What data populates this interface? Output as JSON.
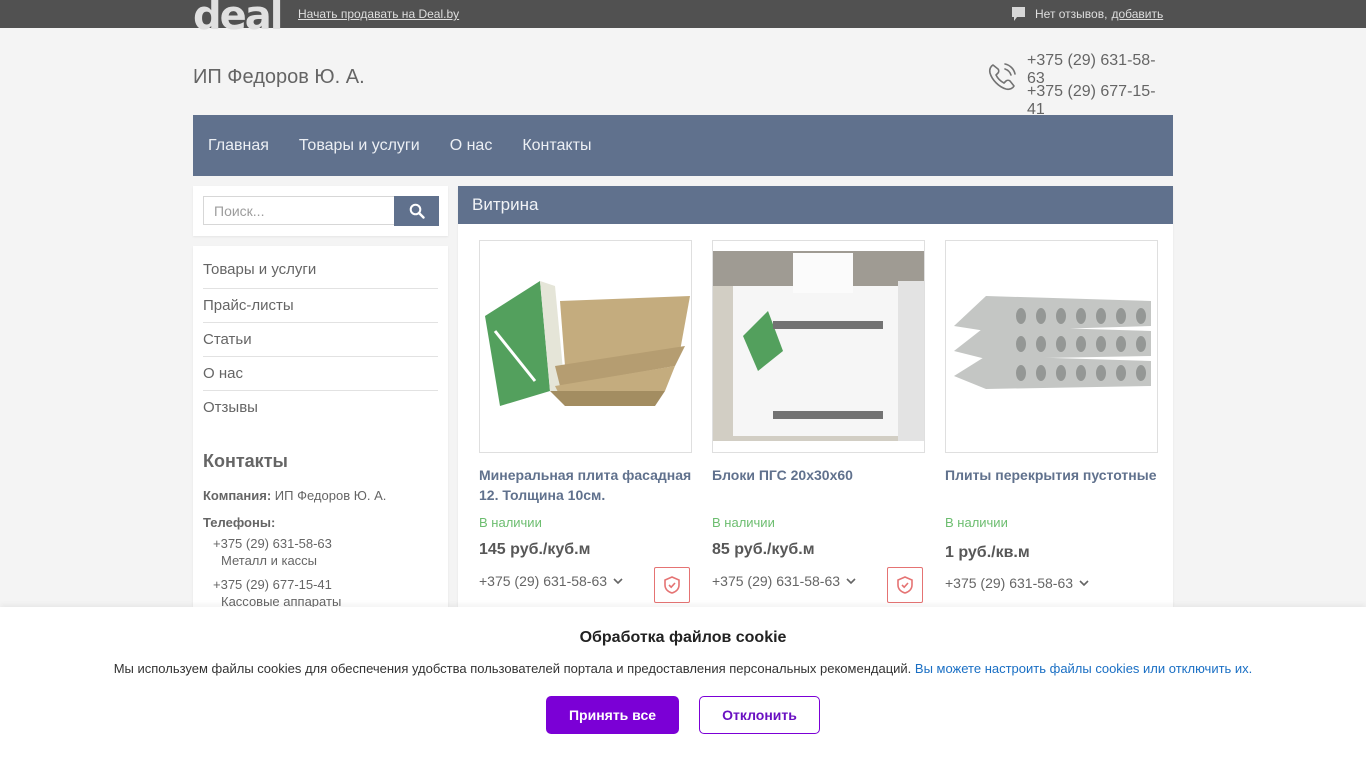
{
  "topbar": {
    "logo": "deal",
    "sell_link": "Начать продавать на Deal.by",
    "reviews_text": "Нет отзывов,",
    "reviews_add": "добавить"
  },
  "header": {
    "company": "ИП Федоров Ю. А.",
    "phone1": "+375 (29) 631-58-63",
    "phone2": "+375 (29) 677-15-41"
  },
  "nav": {
    "items": [
      "Главная",
      "Товары и услуги",
      "О нас",
      "Контакты"
    ]
  },
  "search": {
    "placeholder": "Поиск..."
  },
  "sidebar": {
    "items": [
      "Товары и услуги",
      "Прайс-листы",
      "Статьи",
      "О нас",
      "Отзывы"
    ],
    "contacts_title": "Контакты",
    "company_label": "Компания:",
    "company_value": "ИП Федоров Ю. А.",
    "phones_label": "Телефоны:",
    "phones": [
      {
        "number": "+375 (29) 631-58-63",
        "desc": "Металл и кассы"
      },
      {
        "number": "+375 (29) 677-15-41",
        "desc": "Кассовые аппараты"
      }
    ]
  },
  "main": {
    "title": "Витрина",
    "products": [
      {
        "name": "Минеральная плита фасадная 12. Толщина 10см.",
        "stock": "В наличии",
        "price": "145 руб./куб.м",
        "phone": "+375 (29) 631-58-63"
      },
      {
        "name": "Блоки ПГС 20х30х60",
        "stock": "В наличии",
        "price": "85 руб./куб.м",
        "phone": "+375 (29) 631-58-63"
      },
      {
        "name": "Плиты перекрытия пустотные",
        "stock": "В наличии",
        "price": "1 руб./кв.м",
        "phone": "+375 (29) 631-58-63"
      }
    ]
  },
  "cookie": {
    "title": "Обработка файлов cookie",
    "text": "Мы используем файлы cookies для обеспечения удобства пользователей портала и предоставления персональных рекомендаций.",
    "link": "Вы можете настроить файлы cookies или отключить их.",
    "accept": "Принять все",
    "decline": "Отклонить"
  },
  "colors": {
    "nav_bg": "#3d5274",
    "accent": "#7b00d6",
    "stock": "#4caf50"
  }
}
